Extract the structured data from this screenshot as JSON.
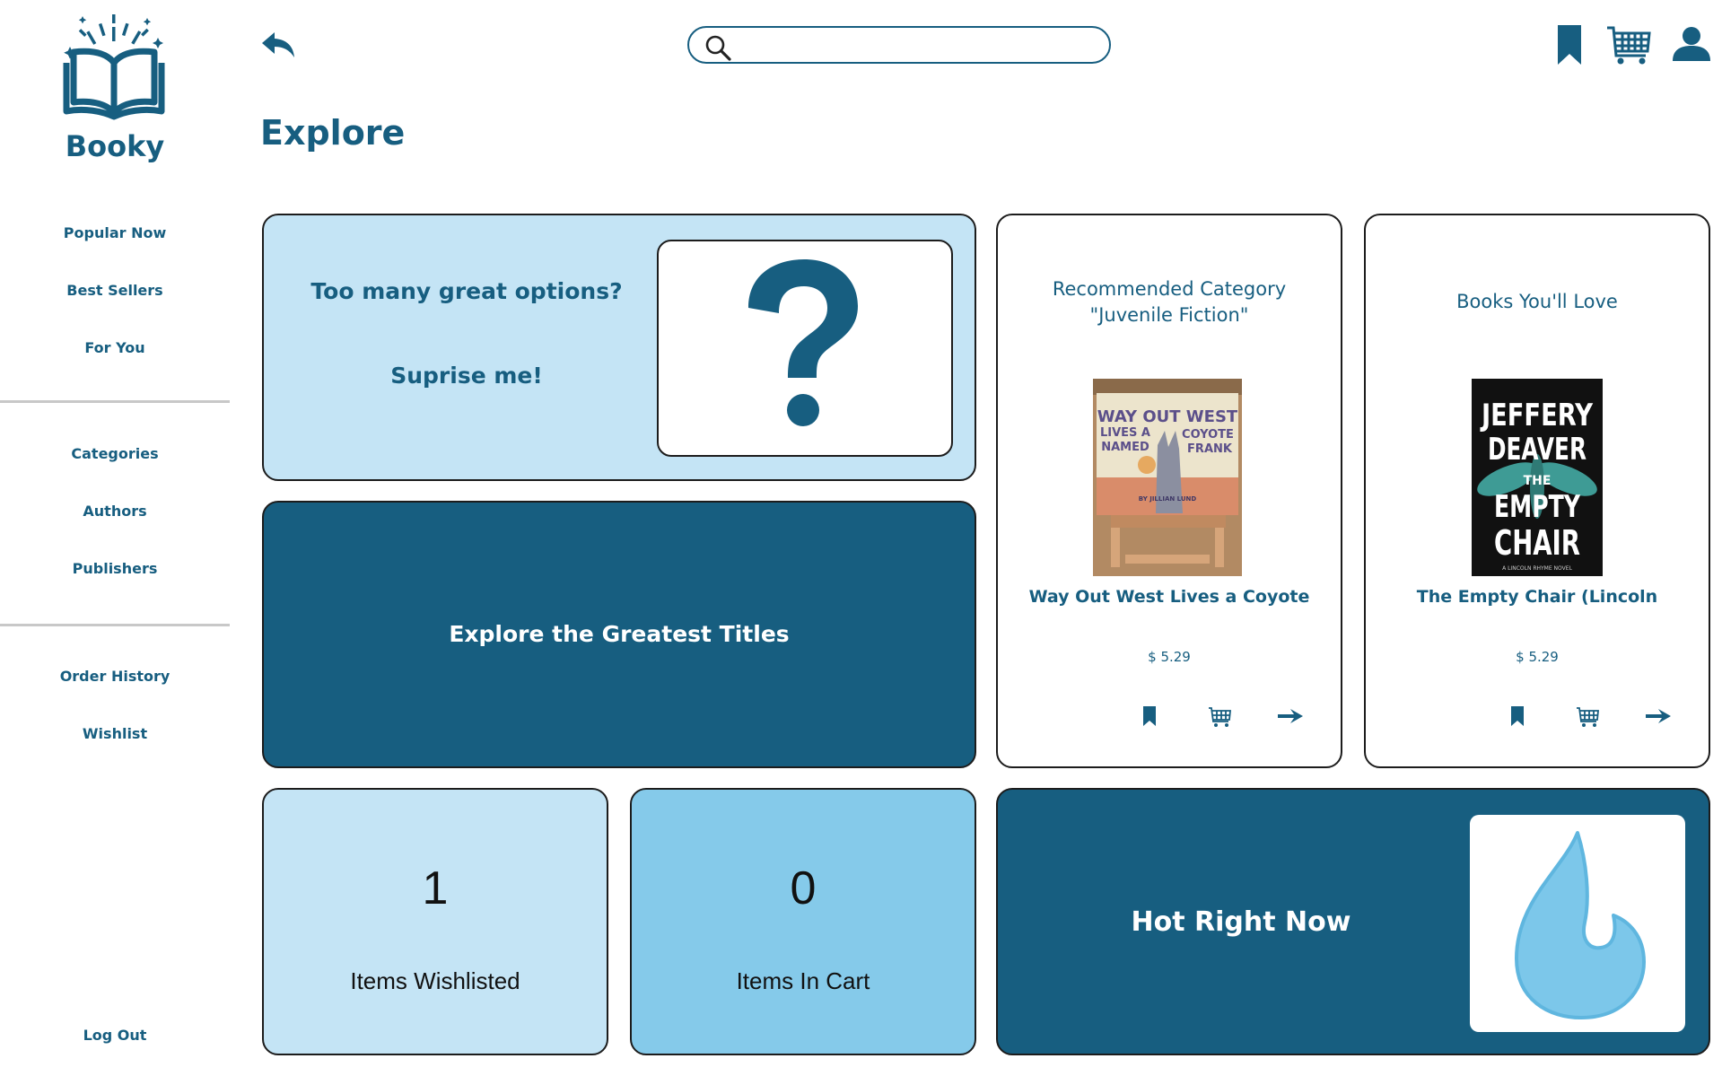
{
  "app": {
    "name": "Booky"
  },
  "sidebar": {
    "items": [
      {
        "label": "Popular Now"
      },
      {
        "label": "Best Sellers"
      },
      {
        "label": "For You"
      },
      {
        "label": "Categories"
      },
      {
        "label": "Authors"
      },
      {
        "label": "Publishers"
      },
      {
        "label": "Order History"
      },
      {
        "label": "Wishlist"
      }
    ],
    "logout_label": "Log Out"
  },
  "header": {
    "search": {
      "value": "",
      "placeholder": ""
    }
  },
  "page": {
    "title": "Explore"
  },
  "surprise_card": {
    "line1": "Too many great options?",
    "line2": "Suprise me!"
  },
  "explore_card": {
    "label": "Explore the Greatest Titles"
  },
  "recommended": [
    {
      "heading_line1": "Recommended Category",
      "heading_line2": "\"Juvenile Fiction\"",
      "book_title": "Way Out West Lives a Coyote",
      "price": "$ 5.29",
      "cover_text": [
        "WAY OUT WEST",
        "LIVES A",
        "COYOTE",
        "NAMED",
        "FRANK",
        "BY JILLIAN LUND"
      ]
    },
    {
      "heading_line1": "Books You'll Love",
      "book_title": "The Empty Chair (Lincoln",
      "price": "$ 5.29",
      "cover_text": [
        "JEFFERY",
        "DEAVER",
        "THE",
        "EMPTY",
        "CHAIR",
        "A LINCOLN RHYME NOVEL"
      ]
    }
  ],
  "stats": {
    "wishlisted": {
      "count": "1",
      "label": "Items Wishlisted"
    },
    "cart": {
      "count": "0",
      "label": "Items In Cart"
    }
  },
  "hot_card": {
    "label": "Hot Right Now"
  },
  "colors": {
    "primary": "#175e80",
    "light_blue": "#c4e4f5",
    "sky_blue": "#85caea",
    "flame": "#7cc7ea"
  },
  "icons": [
    "back-arrow-icon",
    "search-icon",
    "bookmark-icon",
    "cart-icon",
    "user-icon",
    "question-mark-icon",
    "flame-icon",
    "arrow-right-icon"
  ]
}
